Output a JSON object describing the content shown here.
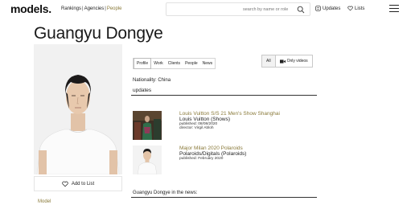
{
  "header": {
    "logo": "models.",
    "nav": [
      {
        "label": "Rankings"
      },
      {
        "label": "Agencies"
      },
      {
        "label": "People"
      }
    ],
    "search_placeholder": "search by name or role",
    "updates_label": "Updates",
    "lists_label": "Lists"
  },
  "profile": {
    "name": "Guangyu Dongye",
    "add_to_list": "Add to List",
    "role": "Model"
  },
  "tabs": [
    {
      "label": "Profile"
    },
    {
      "label": "Work"
    },
    {
      "label": "Clients"
    },
    {
      "label": "People"
    },
    {
      "label": "News"
    }
  ],
  "filters": {
    "all": "All",
    "only_videos": "Only videos"
  },
  "nationality": "Nationality: China",
  "updates_heading": "updates",
  "updates": [
    {
      "title": "Louis Vuitton S/S 21 Men's Show Shanghai",
      "subtitle": "Louis Vuitton (Shows)",
      "published": "published: 08/08/2020",
      "director": "director: Virgil Abloh"
    },
    {
      "title": "Major Milan 2020 Polaroids",
      "subtitle": "Polaroids/Digitals (Polaroids)",
      "published": "published: February 2020"
    }
  ],
  "news_heading": "Guangyu Dongye in the news:",
  "colors": {
    "accent": "#8a7a3a",
    "rule": "#333333"
  }
}
